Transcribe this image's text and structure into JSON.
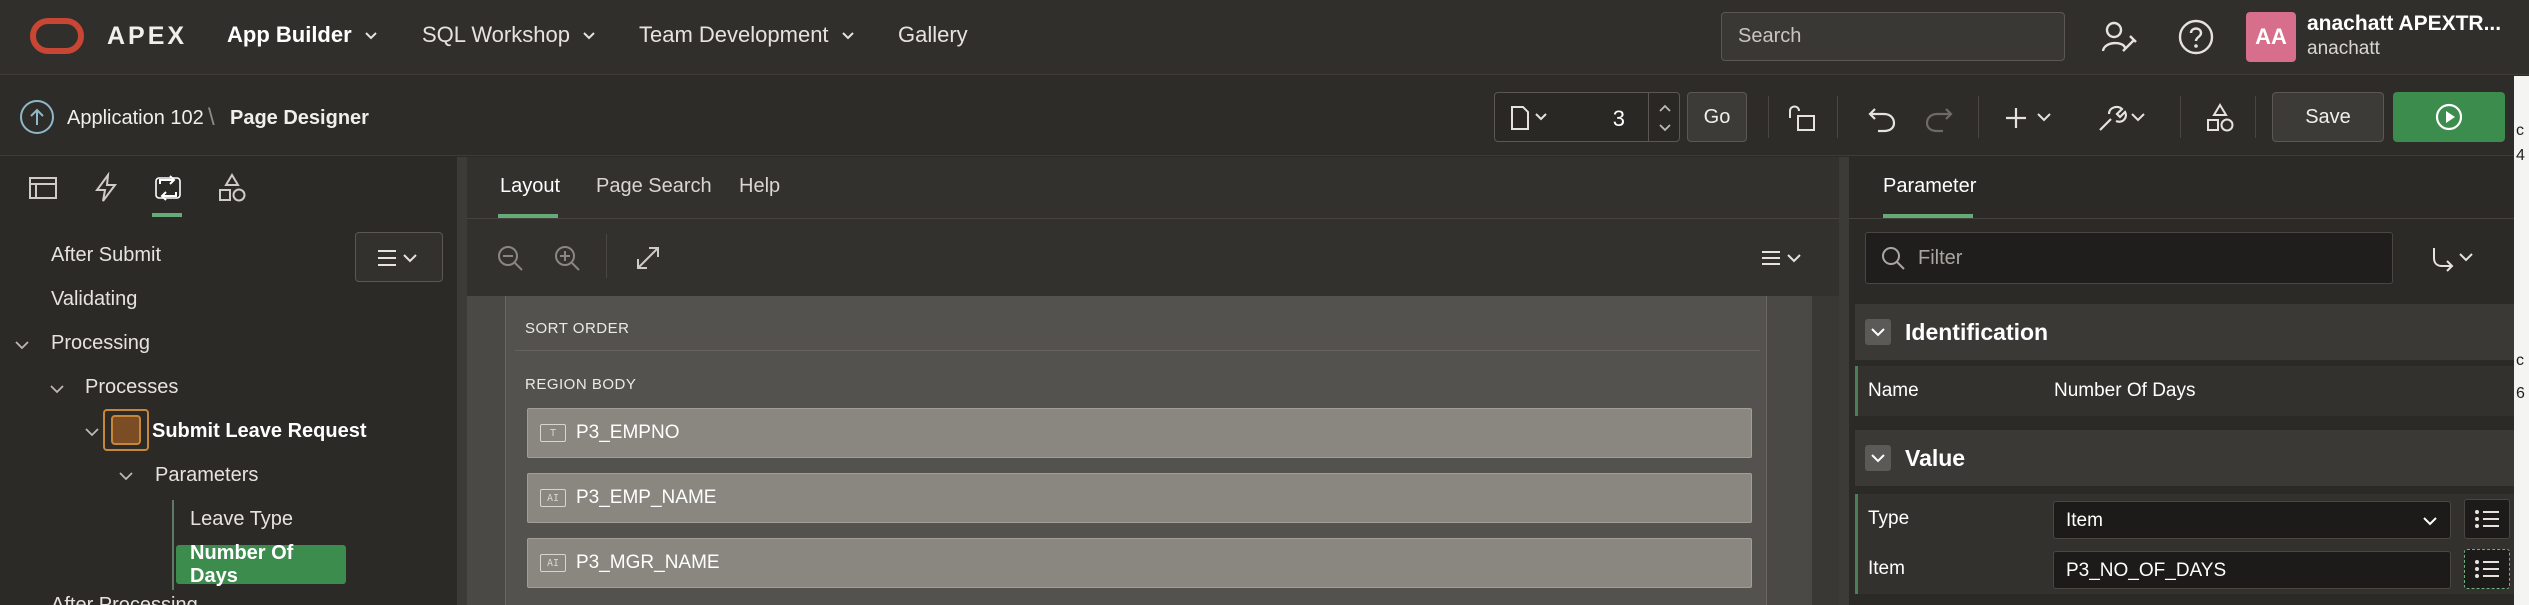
{
  "colors": {
    "accent": "#3c8c4d",
    "brand": "#c74634",
    "avatar": "#d66e8c"
  },
  "topnav": {
    "brand": "APEX",
    "items": [
      "App Builder",
      "SQL Workshop",
      "Team Development",
      "Gallery"
    ],
    "search_placeholder": "Search",
    "user": {
      "initials": "AA",
      "name": "anachatt APEXTR...",
      "username": "anachatt"
    }
  },
  "breadcrumb": {
    "app": "Application 102",
    "separator": "\\",
    "page": "Page Designer"
  },
  "toolbar": {
    "page_number": "3",
    "go_label": "Go",
    "save_label": "Save"
  },
  "left": {
    "tree": [
      {
        "label": "After Submit"
      },
      {
        "label": "Validating"
      },
      {
        "label": "Processing"
      },
      {
        "label": "Processes"
      },
      {
        "label": "Submit Leave Request"
      },
      {
        "label": "Parameters"
      },
      {
        "label": "Leave Type"
      },
      {
        "label": "Number Of Days"
      },
      {
        "label": "After Processing"
      }
    ]
  },
  "center": {
    "tabs": [
      "Layout",
      "Page Search",
      "Help"
    ],
    "region_headers": [
      "SORT ORDER",
      "REGION BODY"
    ],
    "items": [
      {
        "icon": "T",
        "label": "P3_EMPNO"
      },
      {
        "icon": "AI",
        "label": "P3_EMP_NAME"
      },
      {
        "icon": "AI",
        "label": "P3_MGR_NAME"
      }
    ]
  },
  "right": {
    "tab": "Parameter",
    "filter_placeholder": "Filter",
    "groups": [
      {
        "title": "Identification",
        "props": [
          {
            "label": "Name",
            "value": "Number Of Days"
          }
        ]
      },
      {
        "title": "Value",
        "props": [
          {
            "label": "Type",
            "value": "Item"
          },
          {
            "label": "Item",
            "value": "P3_NO_OF_DAYS"
          }
        ]
      }
    ]
  },
  "edge_glyphs": [
    "c",
    "4",
    "c",
    "6"
  ]
}
